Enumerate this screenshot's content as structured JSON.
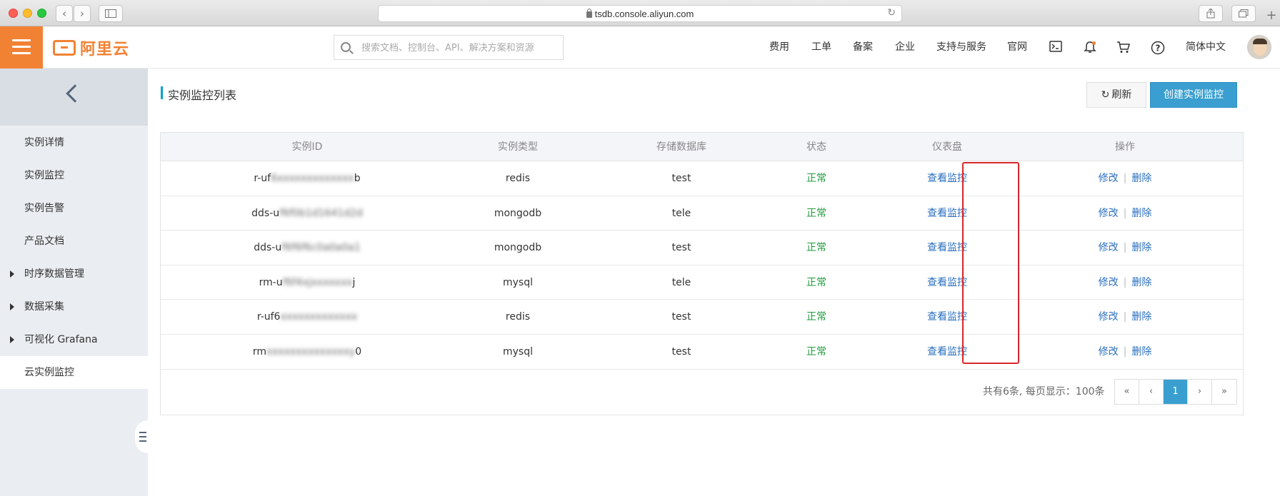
{
  "browser": {
    "url": "tsdb.console.aliyun.com",
    "back_glyph": "‹",
    "forward_glyph": "›"
  },
  "header": {
    "logo_text": "阿里云",
    "search_placeholder": "搜索文档、控制台、API、解决方案和资源",
    "nav": [
      "费用",
      "工单",
      "备案",
      "企业",
      "支持与服务",
      "官网"
    ],
    "language": "简体中文"
  },
  "sidebar": {
    "items": [
      {
        "label": "实例详情",
        "expandable": false
      },
      {
        "label": "实例监控",
        "expandable": false
      },
      {
        "label": "实例告警",
        "expandable": false
      },
      {
        "label": "产品文档",
        "expandable": false
      },
      {
        "label": "时序数据管理",
        "expandable": true
      },
      {
        "label": "数据采集",
        "expandable": true
      },
      {
        "label": "可视化 Grafana",
        "expandable": true
      },
      {
        "label": "云实例监控",
        "expandable": false,
        "active": true
      }
    ]
  },
  "main": {
    "title": "实例监控列表",
    "refresh_label": "刷新",
    "create_label": "创建实例监控",
    "columns": [
      "实例ID",
      "实例类型",
      "存储数据库",
      "状态",
      "仪表盘",
      "操作"
    ],
    "rows": [
      {
        "id_prefix": "r-uf",
        "id_hidden": "6xxxxxxxxxxxxx",
        "id_suffix": "b",
        "type": "redis",
        "db": "test",
        "status": "正常",
        "dashboard": "查看监控",
        "edit": "修改",
        "delete": "删除"
      },
      {
        "id_prefix": "dds-u",
        "id_hidden": "f6f0b1d1641d2d",
        "id_suffix": "",
        "type": "mongodb",
        "db": "tele",
        "status": "正常",
        "dashboard": "查看监控",
        "edit": "修改",
        "delete": "删除"
      },
      {
        "id_prefix": "dds-u",
        "id_hidden": "f6f6f6c0a0a0a1",
        "id_suffix": "",
        "type": "mongodb",
        "db": "test",
        "status": "正常",
        "dashboard": "查看监控",
        "edit": "修改",
        "delete": "删除"
      },
      {
        "id_prefix": "rm-u",
        "id_hidden": "f6f4xjxxxxxxx",
        "id_suffix": "j",
        "type": "mysql",
        "db": "tele",
        "status": "正常",
        "dashboard": "查看监控",
        "edit": "修改",
        "delete": "删除"
      },
      {
        "id_prefix": "r-uf6",
        "id_hidden": "xxxxxxxxxxxxx",
        "id_suffix": "",
        "type": "redis",
        "db": "test",
        "status": "正常",
        "dashboard": "查看监控",
        "edit": "修改",
        "delete": "删除"
      },
      {
        "id_prefix": "rm",
        "id_hidden": "xxxxxxxxxxxxxxy",
        "id_suffix": "0",
        "type": "mysql",
        "db": "test",
        "status": "正常",
        "dashboard": "查看监控",
        "edit": "修改",
        "delete": "删除"
      }
    ],
    "pagination": {
      "summary": "共有6条, 每页显示：100条",
      "first": "«",
      "prev": "‹",
      "current": "1",
      "next": "›",
      "last": "»"
    }
  },
  "colors": {
    "brand": "#f28233",
    "primary": "#3a9fd0",
    "status_ok": "#1e9b3b",
    "link": "#2a6fbf",
    "highlight": "#d9262c"
  }
}
